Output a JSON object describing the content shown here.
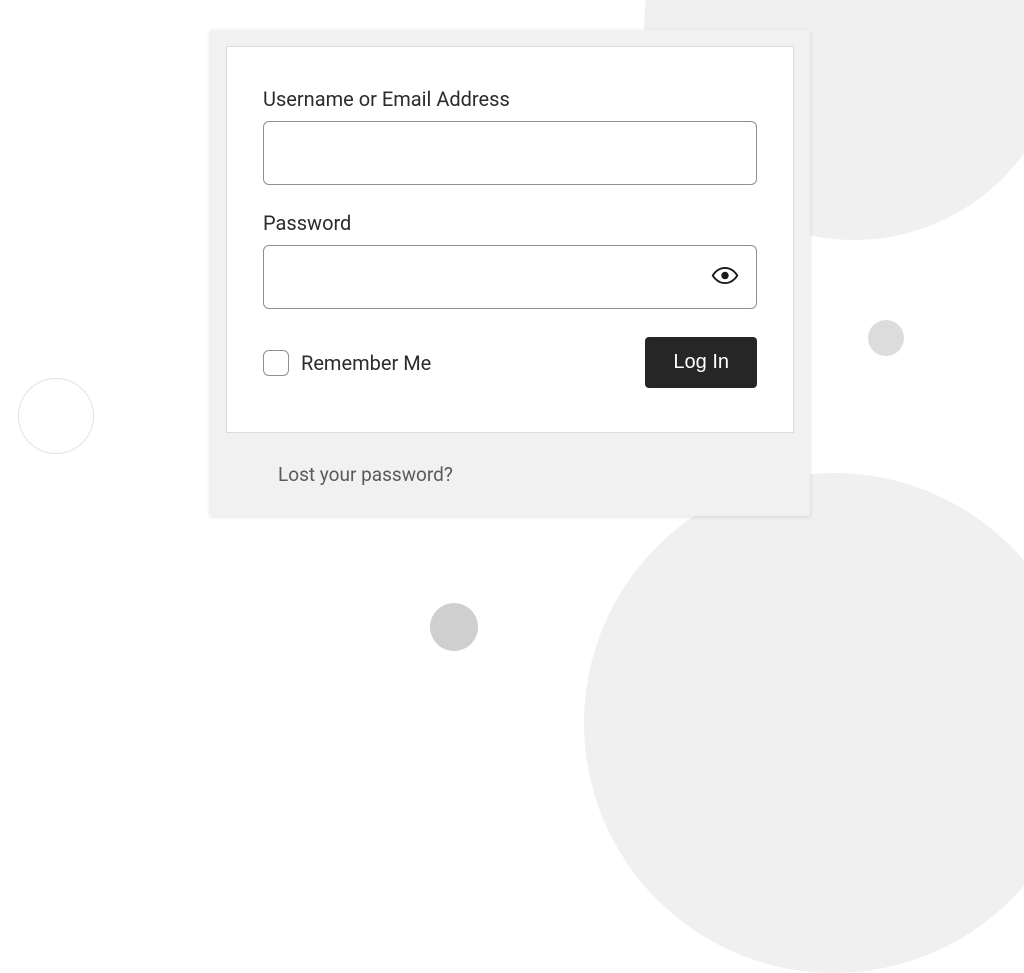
{
  "form": {
    "username_label": "Username or Email Address",
    "username_value": "",
    "password_label": "Password",
    "password_value": "",
    "remember_label": "Remember Me",
    "submit_label": "Log In"
  },
  "links": {
    "lost_password": "Lost your password?"
  }
}
